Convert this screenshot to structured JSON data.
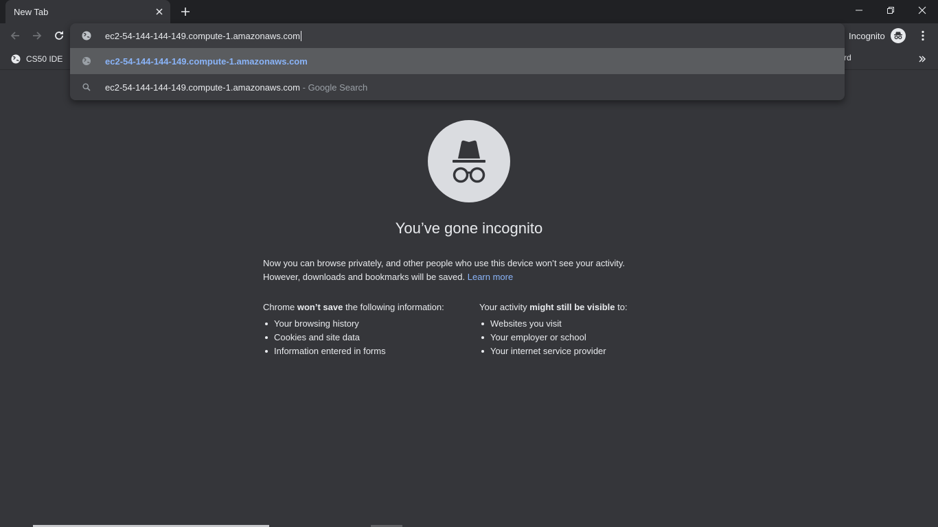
{
  "tab": {
    "title": "New Tab"
  },
  "window_controls": [
    "minimize",
    "restore",
    "close"
  ],
  "omnibox": {
    "value": "ec2-54-144-144-149.compute-1.amazonaws.com",
    "suggestions": [
      {
        "icon": "globe-icon",
        "text": "ec2-54-144-144-149.compute-1.amazonaws.com",
        "selected": true
      },
      {
        "icon": "search-icon",
        "text": "ec2-54-144-144-149.compute-1.amazonaws.com",
        "desc": "- Google Search"
      }
    ]
  },
  "profile": {
    "label": "Incognito"
  },
  "bookmarks": {
    "items": [
      {
        "label": "CS50 IDE",
        "icon": "globe-icon"
      }
    ],
    "partial_label": "rd"
  },
  "page": {
    "heading": "You’ve gone incognito",
    "desc_line1": "Now you can browse privately, and other people who use this device won’t see your activity.",
    "desc_line2": "However, downloads and bookmarks will be saved.",
    "learn_more": "Learn more",
    "left_col": {
      "title_pre": "Chrome ",
      "title_bold": "won’t save",
      "title_post": " the following information:",
      "items": [
        "Your browsing history",
        "Cookies and site data",
        "Information entered in forms"
      ]
    },
    "right_col": {
      "title_pre": "Your activity ",
      "title_bold": "might still be visible",
      "title_post": " to:",
      "items": [
        "Websites you visit",
        "Your employer or school",
        "Your internet service provider"
      ]
    }
  },
  "colors": {
    "frame": "#202124",
    "toolbar": "#35363a",
    "omnibox": "#3c3d41",
    "selected_row": "#5a5c5f",
    "link": "#8ab4f8"
  }
}
